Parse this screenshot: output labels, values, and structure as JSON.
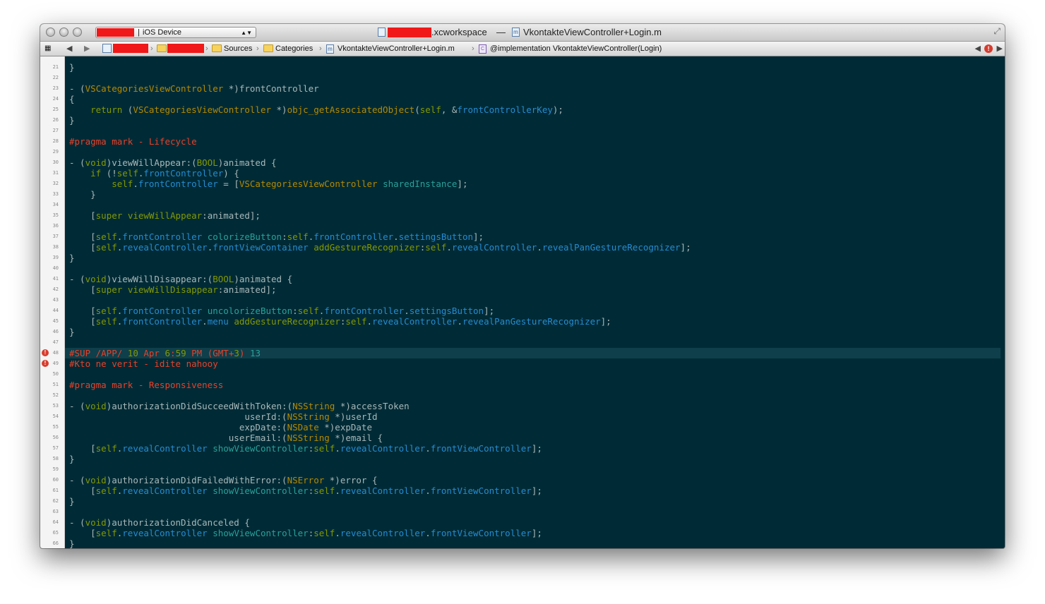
{
  "window": {
    "scheme_device": "iOS Device",
    "workspace_suffix": ".xcworkspace",
    "title_separator": "—",
    "file_icon_letter": "m",
    "file_name": "VkontakteViewController+Login.m"
  },
  "jumpbar": {
    "items": [
      "Sources",
      "Categories",
      "VkontakteViewController+Login.m",
      "@implementation VkontakteViewController(Login)"
    ],
    "separator": "›"
  },
  "colors": {
    "background": "#002b36",
    "keyword": "#849900",
    "type": "#b58900",
    "property": "#268bd2",
    "method": "#2aa198",
    "preprocessor": "#e8412a",
    "text": "#a8b8ba"
  },
  "editor": {
    "lines": [
      {
        "n": "21",
        "t": [
          [
            "}",
            ""
          ]
        ]
      },
      {
        "n": "22",
        "t": []
      },
      {
        "n": "23",
        "t": [
          [
            "- (",
            ""
          ],
          [
            "VSCategoriesViewController",
            "ty"
          ],
          [
            " *)frontController",
            ""
          ]
        ]
      },
      {
        "n": "24",
        "t": [
          [
            "{",
            ""
          ]
        ]
      },
      {
        "n": "25",
        "t": [
          [
            "    ",
            ""
          ],
          [
            "return",
            "kw"
          ],
          [
            " (",
            ""
          ],
          [
            "VSCategoriesViewController",
            "ty"
          ],
          [
            " *)",
            ""
          ],
          [
            "objc_getAssociatedObject",
            "ty"
          ],
          [
            "(",
            ""
          ],
          [
            "self",
            "kw"
          ],
          [
            ", &",
            ""
          ],
          [
            "frontControllerKey",
            "pr"
          ],
          [
            ");",
            ""
          ]
        ]
      },
      {
        "n": "26",
        "t": [
          [
            "}",
            ""
          ]
        ]
      },
      {
        "n": "27",
        "t": []
      },
      {
        "n": "28",
        "t": [
          [
            "#pragma mark - Lifecycle",
            "pp"
          ]
        ]
      },
      {
        "n": "29",
        "t": []
      },
      {
        "n": "30",
        "t": [
          [
            "- (",
            ""
          ],
          [
            "void",
            "kw"
          ],
          [
            ")viewWillAppear:(",
            ""
          ],
          [
            "BOOL",
            "kw"
          ],
          [
            ")animated {",
            ""
          ]
        ]
      },
      {
        "n": "31",
        "t": [
          [
            "    ",
            ""
          ],
          [
            "if",
            "kw"
          ],
          [
            " (!",
            ""
          ],
          [
            "self",
            "kw"
          ],
          [
            ".",
            ""
          ],
          [
            "frontController",
            "pr"
          ],
          [
            ") {",
            ""
          ]
        ]
      },
      {
        "n": "32",
        "t": [
          [
            "        ",
            ""
          ],
          [
            "self",
            "kw"
          ],
          [
            ".",
            ""
          ],
          [
            "frontController",
            "pr"
          ],
          [
            " = [",
            ""
          ],
          [
            "VSCategoriesViewController",
            "ty"
          ],
          [
            " ",
            ""
          ],
          [
            "sharedInstance",
            "mt"
          ],
          [
            "];",
            ""
          ]
        ]
      },
      {
        "n": "33",
        "t": [
          [
            "    }",
            ""
          ]
        ]
      },
      {
        "n": "34",
        "t": []
      },
      {
        "n": "35",
        "t": [
          [
            "    [",
            ""
          ],
          [
            "super",
            "kw"
          ],
          [
            " ",
            ""
          ],
          [
            "viewWillAppear",
            "kw"
          ],
          [
            ":animated];",
            ""
          ]
        ]
      },
      {
        "n": "36",
        "t": []
      },
      {
        "n": "37",
        "t": [
          [
            "    [",
            ""
          ],
          [
            "self",
            "kw"
          ],
          [
            ".",
            ""
          ],
          [
            "frontController",
            "pr"
          ],
          [
            " ",
            ""
          ],
          [
            "colorizeButton",
            "mt"
          ],
          [
            ":",
            ""
          ],
          [
            "self",
            "kw"
          ],
          [
            ".",
            ""
          ],
          [
            "frontController",
            "pr"
          ],
          [
            ".",
            ""
          ],
          [
            "settingsButton",
            "pr"
          ],
          [
            "];",
            ""
          ]
        ]
      },
      {
        "n": "38",
        "t": [
          [
            "    [",
            ""
          ],
          [
            "self",
            "kw"
          ],
          [
            ".",
            ""
          ],
          [
            "revealController",
            "pr"
          ],
          [
            ".",
            ""
          ],
          [
            "frontViewContainer",
            "pr"
          ],
          [
            " ",
            ""
          ],
          [
            "addGestureRecognizer",
            "kw"
          ],
          [
            ":",
            ""
          ],
          [
            "self",
            "kw"
          ],
          [
            ".",
            ""
          ],
          [
            "revealController",
            "pr"
          ],
          [
            ".",
            ""
          ],
          [
            "revealPanGestureRecognizer",
            "pr"
          ],
          [
            "];",
            ""
          ]
        ]
      },
      {
        "n": "39",
        "t": [
          [
            "}",
            ""
          ]
        ]
      },
      {
        "n": "40",
        "t": []
      },
      {
        "n": "41",
        "t": [
          [
            "- (",
            ""
          ],
          [
            "void",
            "kw"
          ],
          [
            ")viewWillDisappear:(",
            ""
          ],
          [
            "BOOL",
            "kw"
          ],
          [
            ")animated {",
            ""
          ]
        ]
      },
      {
        "n": "42",
        "t": [
          [
            "    [",
            ""
          ],
          [
            "super",
            "kw"
          ],
          [
            " ",
            ""
          ],
          [
            "viewWillDisappear",
            "kw"
          ],
          [
            ":animated];",
            ""
          ]
        ]
      },
      {
        "n": "43",
        "t": []
      },
      {
        "n": "44",
        "t": [
          [
            "    [",
            ""
          ],
          [
            "self",
            "kw"
          ],
          [
            ".",
            ""
          ],
          [
            "frontController",
            "pr"
          ],
          [
            " ",
            ""
          ],
          [
            "uncolorizeButton",
            "mt"
          ],
          [
            ":",
            ""
          ],
          [
            "self",
            "kw"
          ],
          [
            ".",
            ""
          ],
          [
            "frontController",
            "pr"
          ],
          [
            ".",
            ""
          ],
          [
            "settingsButton",
            "pr"
          ],
          [
            "];",
            ""
          ]
        ]
      },
      {
        "n": "45",
        "t": [
          [
            "    [",
            ""
          ],
          [
            "self",
            "kw"
          ],
          [
            ".",
            ""
          ],
          [
            "frontController",
            "pr"
          ],
          [
            ".",
            ""
          ],
          [
            "menu",
            "pr"
          ],
          [
            " ",
            ""
          ],
          [
            "addGestureRecognizer",
            "kw"
          ],
          [
            ":",
            ""
          ],
          [
            "self",
            "kw"
          ],
          [
            ".",
            ""
          ],
          [
            "revealController",
            "pr"
          ],
          [
            ".",
            ""
          ],
          [
            "revealPanGestureRecognizer",
            "pr"
          ],
          [
            "];",
            ""
          ]
        ]
      },
      {
        "n": "46",
        "t": [
          [
            "}",
            ""
          ]
        ]
      },
      {
        "n": "47",
        "t": []
      },
      {
        "n": "48",
        "err": true,
        "cur": true,
        "t": [
          [
            "#SUP /APP/ ",
            "pp"
          ],
          [
            "10",
            "kw"
          ],
          [
            " Apr ",
            "pp"
          ],
          [
            "6",
            "kw"
          ],
          [
            ":",
            "pp"
          ],
          [
            "59",
            "kw"
          ],
          [
            " PM (GMT+",
            "pp"
          ],
          [
            "3",
            "kw"
          ],
          [
            ") ",
            "pp"
          ],
          [
            "13",
            "mt"
          ]
        ]
      },
      {
        "n": "49",
        "err": true,
        "t": [
          [
            "#Kto ne verit - idite nahooy",
            "pp"
          ]
        ]
      },
      {
        "n": "50",
        "t": []
      },
      {
        "n": "51",
        "t": [
          [
            "#pragma mark - Responsiveness",
            "pp"
          ]
        ]
      },
      {
        "n": "52",
        "t": []
      },
      {
        "n": "53",
        "t": [
          [
            "- (",
            ""
          ],
          [
            "void",
            "kw"
          ],
          [
            ")authorizationDidSucceedWithToken:(",
            ""
          ],
          [
            "NSString",
            "ty"
          ],
          [
            " *)accessToken",
            ""
          ]
        ]
      },
      {
        "n": "54",
        "t": [
          [
            "                                 userId:(",
            ""
          ],
          [
            "NSString",
            "ty"
          ],
          [
            " *)userId",
            ""
          ]
        ]
      },
      {
        "n": "55",
        "t": [
          [
            "                                expDate:(",
            ""
          ],
          [
            "NSDate",
            "ty"
          ],
          [
            " *)expDate",
            ""
          ]
        ]
      },
      {
        "n": "56",
        "t": [
          [
            "                              userEmail:(",
            ""
          ],
          [
            "NSString",
            "ty"
          ],
          [
            " *)email {",
            ""
          ]
        ]
      },
      {
        "n": "57",
        "t": [
          [
            "    [",
            ""
          ],
          [
            "self",
            "kw"
          ],
          [
            ".",
            ""
          ],
          [
            "revealController",
            "pr"
          ],
          [
            " ",
            ""
          ],
          [
            "showViewController",
            "mt"
          ],
          [
            ":",
            ""
          ],
          [
            "self",
            "kw"
          ],
          [
            ".",
            ""
          ],
          [
            "revealController",
            "pr"
          ],
          [
            ".",
            ""
          ],
          [
            "frontViewController",
            "pr"
          ],
          [
            "];",
            ""
          ]
        ]
      },
      {
        "n": "58",
        "t": [
          [
            "}",
            ""
          ]
        ]
      },
      {
        "n": "59",
        "t": []
      },
      {
        "n": "60",
        "t": [
          [
            "- (",
            ""
          ],
          [
            "void",
            "kw"
          ],
          [
            ")authorizationDidFailedWithError:(",
            ""
          ],
          [
            "NSError",
            "ty"
          ],
          [
            " *)error {",
            ""
          ]
        ]
      },
      {
        "n": "61",
        "t": [
          [
            "    [",
            ""
          ],
          [
            "self",
            "kw"
          ],
          [
            ".",
            ""
          ],
          [
            "revealController",
            "pr"
          ],
          [
            " ",
            ""
          ],
          [
            "showViewController",
            "mt"
          ],
          [
            ":",
            ""
          ],
          [
            "self",
            "kw"
          ],
          [
            ".",
            ""
          ],
          [
            "revealController",
            "pr"
          ],
          [
            ".",
            ""
          ],
          [
            "frontViewController",
            "pr"
          ],
          [
            "];",
            ""
          ]
        ]
      },
      {
        "n": "62",
        "t": [
          [
            "}",
            ""
          ]
        ]
      },
      {
        "n": "63",
        "t": []
      },
      {
        "n": "64",
        "t": [
          [
            "- (",
            ""
          ],
          [
            "void",
            "kw"
          ],
          [
            ")authorizationDidCanceled {",
            ""
          ]
        ]
      },
      {
        "n": "65",
        "t": [
          [
            "    [",
            ""
          ],
          [
            "self",
            "kw"
          ],
          [
            ".",
            ""
          ],
          [
            "revealController",
            "pr"
          ],
          [
            " ",
            ""
          ],
          [
            "showViewController",
            "mt"
          ],
          [
            ":",
            ""
          ],
          [
            "self",
            "kw"
          ],
          [
            ".",
            ""
          ],
          [
            "revealController",
            "pr"
          ],
          [
            ".",
            ""
          ],
          [
            "frontViewController",
            "pr"
          ],
          [
            "];",
            ""
          ]
        ]
      },
      {
        "n": "66",
        "t": [
          [
            "}",
            ""
          ]
        ]
      }
    ]
  }
}
